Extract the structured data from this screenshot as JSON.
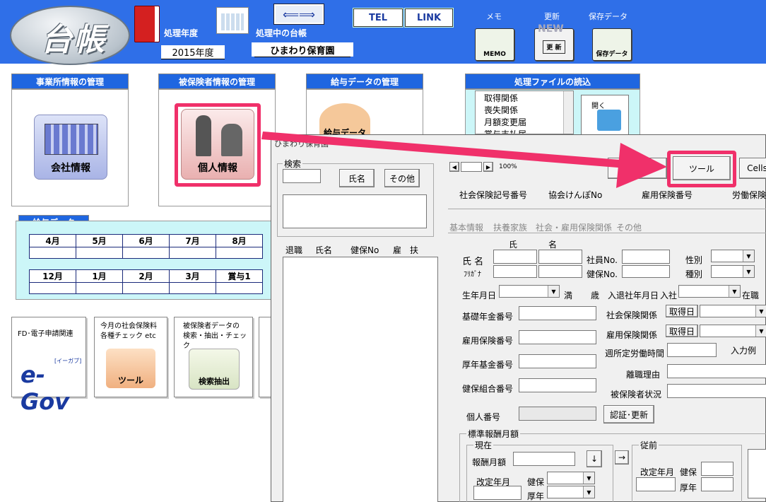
{
  "app": {
    "logo": "台帳"
  },
  "header": {
    "fiscal_year_label": "処理年度",
    "fiscal_year_value": "2015年度",
    "ledger_label": "処理中の台帳",
    "ledger_value": "ひまわり保育園",
    "tel": "TEL",
    "link": "LINK",
    "memo_label": "メモ",
    "memo_icon_text": "MEMO",
    "update_label": "更新",
    "update_icon_text": "NEW",
    "update_icon_sub": "更 新",
    "save_label": "保存データ",
    "save_icon_text": "保存データ"
  },
  "panels": {
    "company": {
      "title": "事業所情報の管理",
      "icon": "会社情報"
    },
    "insured": {
      "title": "被保険者情報の管理",
      "icon": "個人情報"
    },
    "salary": {
      "title": "給与データの管理",
      "icon": "給与データ"
    },
    "files": {
      "title": "処理ファイルの読込",
      "items": [
        "取得関係",
        "喪失関係",
        "月額変更届",
        "賞与支払届"
      ],
      "open": "開く"
    }
  },
  "salary_table": {
    "title": "給与データ",
    "row1": [
      "4月",
      "5月",
      "6月",
      "7月",
      "8月"
    ],
    "row2": [
      "12月",
      "1月",
      "2月",
      "3月",
      "賞与1"
    ]
  },
  "tools": {
    "egov_title": "FD･電子申請関連",
    "egov_logo": "e-Gov",
    "egov_sub": "[イーガブ]",
    "check_title1": "今月の社会保険料",
    "check_title2": "各種チェック etc",
    "check_icon": "ツール",
    "search_title1": "被保険者データの",
    "search_title2": "検索・抽出・チェック",
    "search_icon": "検索抽出"
  },
  "window": {
    "title": "ひまわり保育園",
    "search_group": "検索",
    "name_btn": "氏名",
    "other_btn": "その他",
    "list_headers": [
      "退職",
      "氏名",
      "健保No",
      "雇",
      "扶"
    ],
    "zoom": "100%",
    "tool_btn": "ツール",
    "cells_btn": "Cells",
    "top_labels": [
      "社会保険記号番号",
      "協会けんぽNo",
      "雇用保険番号",
      "労働保険"
    ],
    "tabs": [
      "基本情報",
      "扶養家族",
      "社会・雇用保険関係",
      "その他"
    ],
    "f": {
      "shi": "氏",
      "mei": "名",
      "name": "氏 名",
      "kana": "ﾌﾘｶﾞﾅ",
      "emp_no": "社員No.",
      "kenpo_no": "健保No.",
      "sex": "性別",
      "kind": "種別",
      "birth": "生年月日",
      "age_mark": "満",
      "age_unit": "歳",
      "join_date": "入退社年月日",
      "join": "入社",
      "status": "在職",
      "pension": "基礎年金番号",
      "shaho": "社会保険関係",
      "acquire1": "取得日",
      "koyo_no": "雇用保険番号",
      "koyo": "雇用保険関係",
      "acquire2": "取得日",
      "welfare": "厚年基金番号",
      "hours": "週所定労働時間",
      "example": "入力例",
      "kumiai": "健保組合番号",
      "leave": "離職理由",
      "insured_status": "被保険者状況",
      "mynumber": "個人番号",
      "auth": "認証･更新",
      "std_group": "標準報酬月額",
      "current": "現在",
      "previous": "従前",
      "monthly": "報酬月額",
      "down": "↓",
      "right": "→",
      "rev_month": "改定年月",
      "kenpo": "健保",
      "kounen": "厚年",
      "rev_month2": "改定年月",
      "kenpo2": "健保",
      "kounen2": "厚年"
    }
  },
  "colors": {
    "header_blue": "#2f6fe8",
    "panel_blue": "#1f66e0",
    "highlight": "#f0306a",
    "salary_bg": "#ccf6f8"
  }
}
